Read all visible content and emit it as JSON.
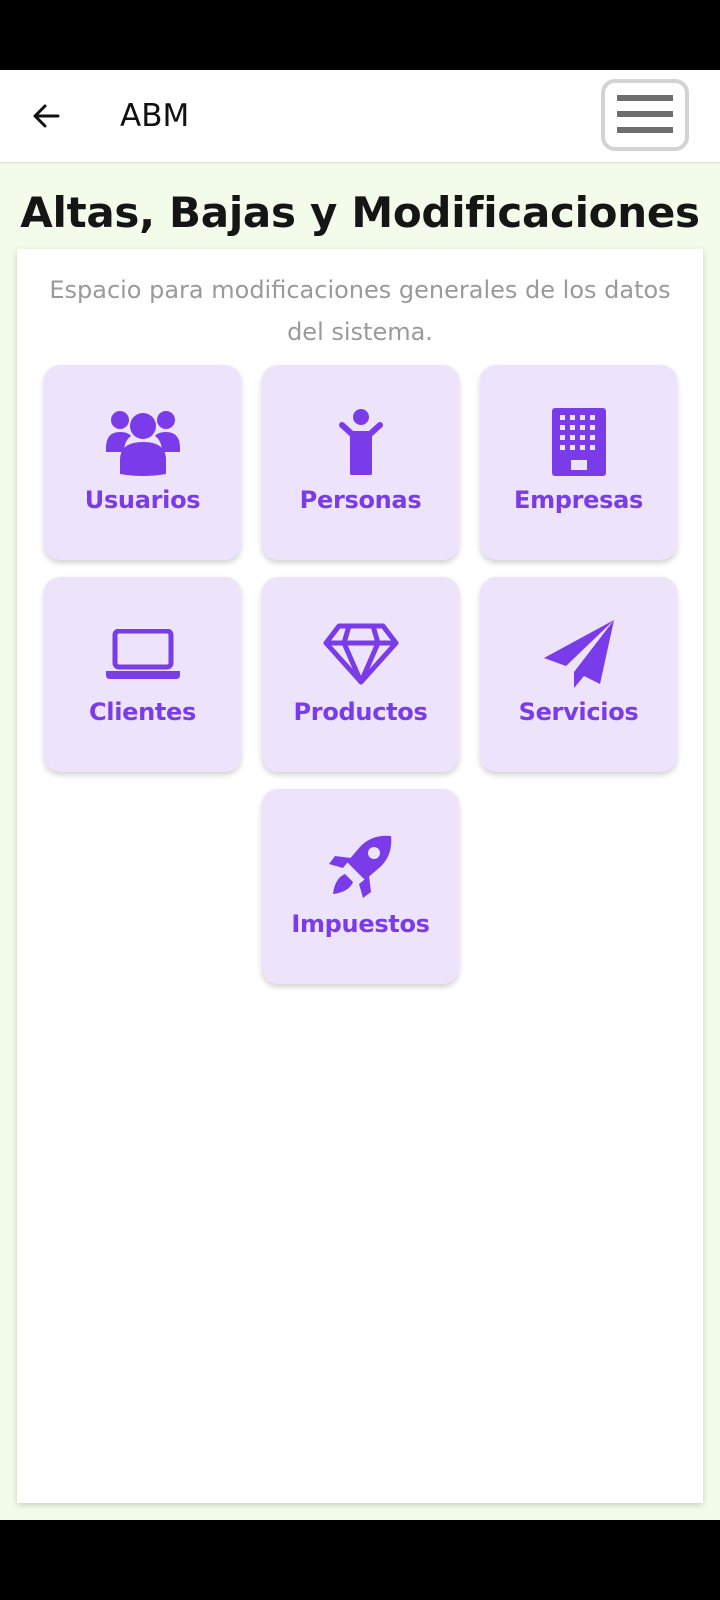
{
  "app_bar": {
    "title": "ABM",
    "back_icon": "arrow-left-icon",
    "menu_icon": "hamburger-menu-icon"
  },
  "page": {
    "title": "Altas, Bajas y Modificaciones",
    "description": "Espacio para modificaciones generales de los datos del sistema."
  },
  "tiles": [
    {
      "label": "Usuarios",
      "icon": "users-icon"
    },
    {
      "label": "Personas",
      "icon": "person-icon"
    },
    {
      "label": "Empresas",
      "icon": "building-icon"
    },
    {
      "label": "Clientes",
      "icon": "laptop-icon"
    },
    {
      "label": "Productos",
      "icon": "diamond-icon"
    },
    {
      "label": "Servicios",
      "icon": "paper-plane-icon"
    },
    {
      "label": "Impuestos",
      "icon": "rocket-icon"
    }
  ],
  "colors": {
    "accent": "#7a3be8",
    "tile_bg": "#ede3fb",
    "page_bg": "#f3fbea"
  }
}
